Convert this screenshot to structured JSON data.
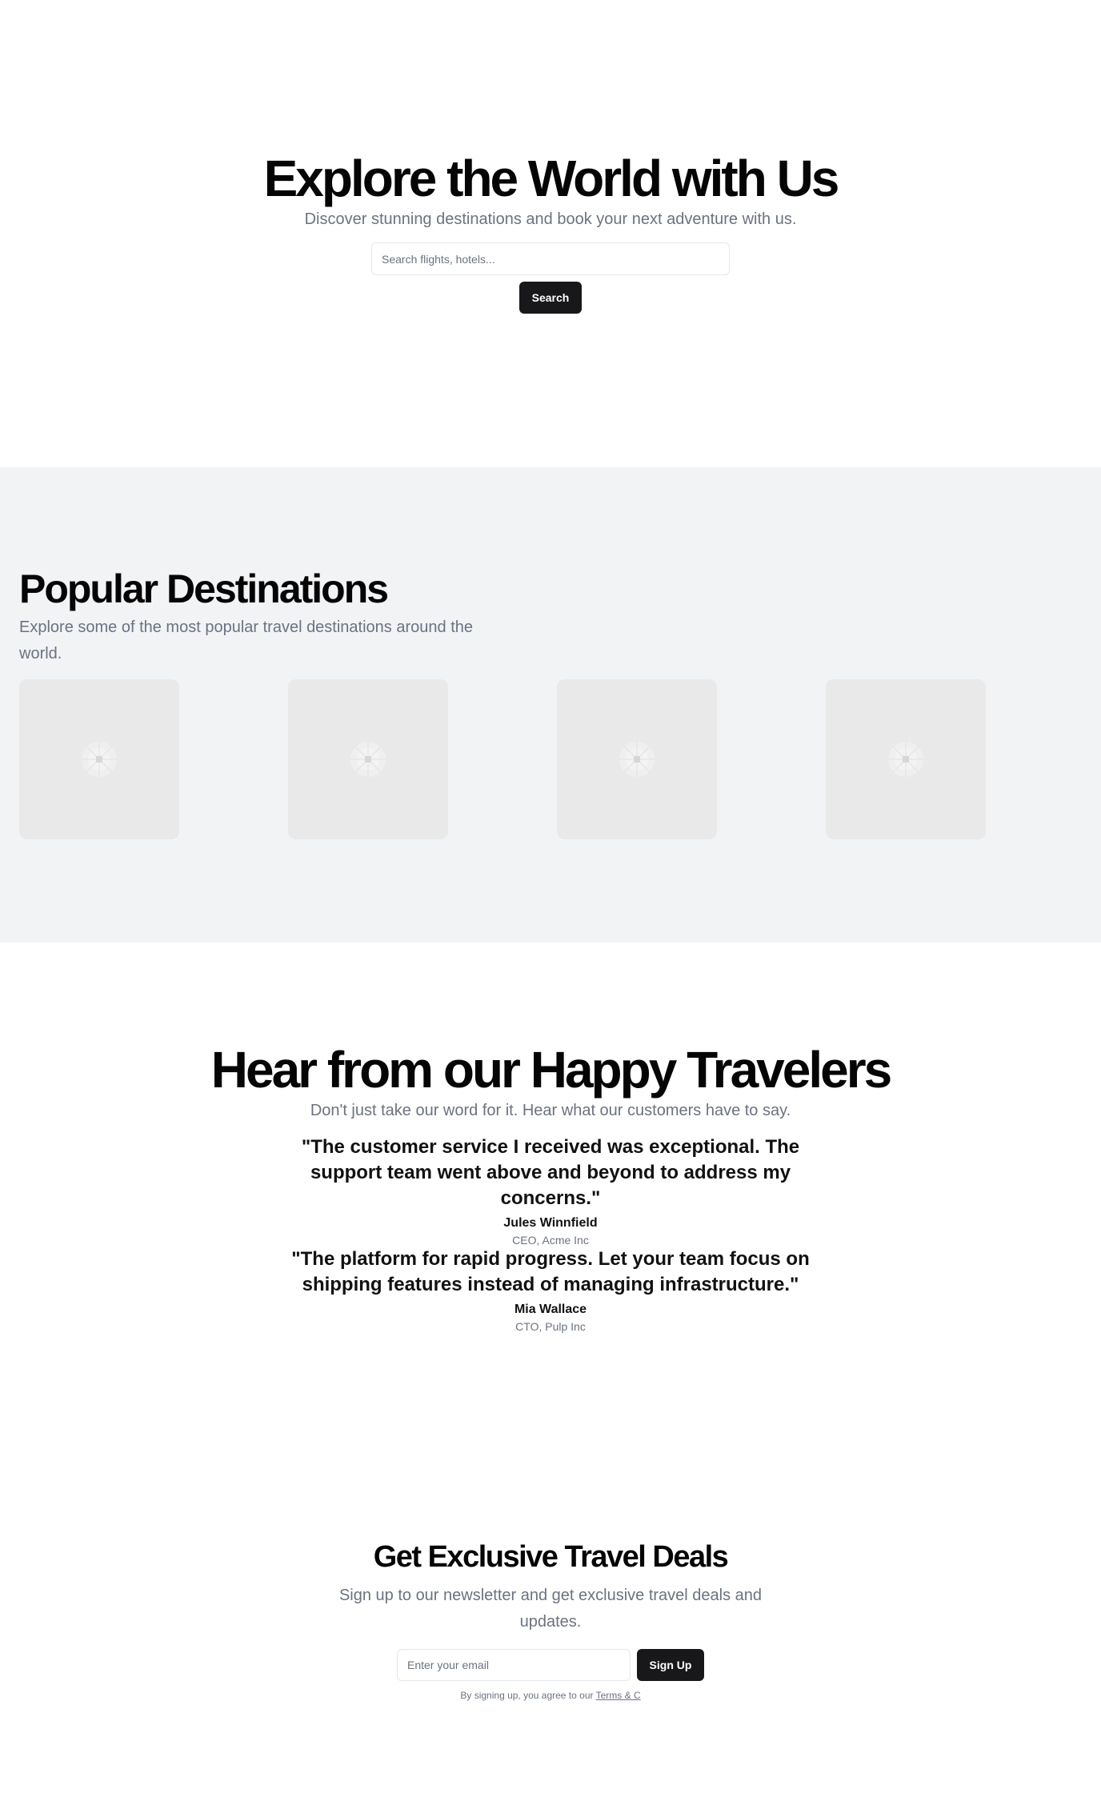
{
  "hero": {
    "title": "Explore the World with Us",
    "subtitle": "Discover stunning destinations and book your next adventure with us.",
    "search_placeholder": "Search flights, hotels...",
    "search_button": "Search"
  },
  "destinations": {
    "title": "Popular Destinations",
    "subtitle": "Explore some of the most popular travel destinations around the world.",
    "cards": [
      {
        "icon": "image-placeholder-icon"
      },
      {
        "icon": "image-placeholder-icon"
      },
      {
        "icon": "image-placeholder-icon"
      },
      {
        "icon": "image-placeholder-icon"
      }
    ]
  },
  "testimonials": {
    "title": "Hear from our Happy Travelers",
    "subtitle": "Don't just take our word for it. Hear what our customers have to say.",
    "items": [
      {
        "quote": "\"The customer service I received was exceptional. The support team went above and beyond to address my concerns.\"",
        "name": "Jules Winnfield",
        "role": "CEO, Acme Inc"
      },
      {
        "quote": "\"The platform for rapid progress. Let your team focus on shipping features instead of managing infrastructure.\"",
        "name": "Mia Wallace",
        "role": "CTO, Pulp Inc"
      }
    ]
  },
  "newsletter": {
    "title": "Get Exclusive Travel Deals",
    "subtitle": "Sign up to our newsletter and get exclusive travel deals and updates.",
    "email_placeholder": "Enter your email",
    "signup_button": "Sign Up",
    "terms_prefix": "By signing up, you agree to our ",
    "terms_link": "Terms & C"
  },
  "colors": {
    "primary_button": "#18181b",
    "muted_text": "#6b7280",
    "section_bg": "#f2f3f5",
    "card_bg": "#e9e9e9"
  }
}
